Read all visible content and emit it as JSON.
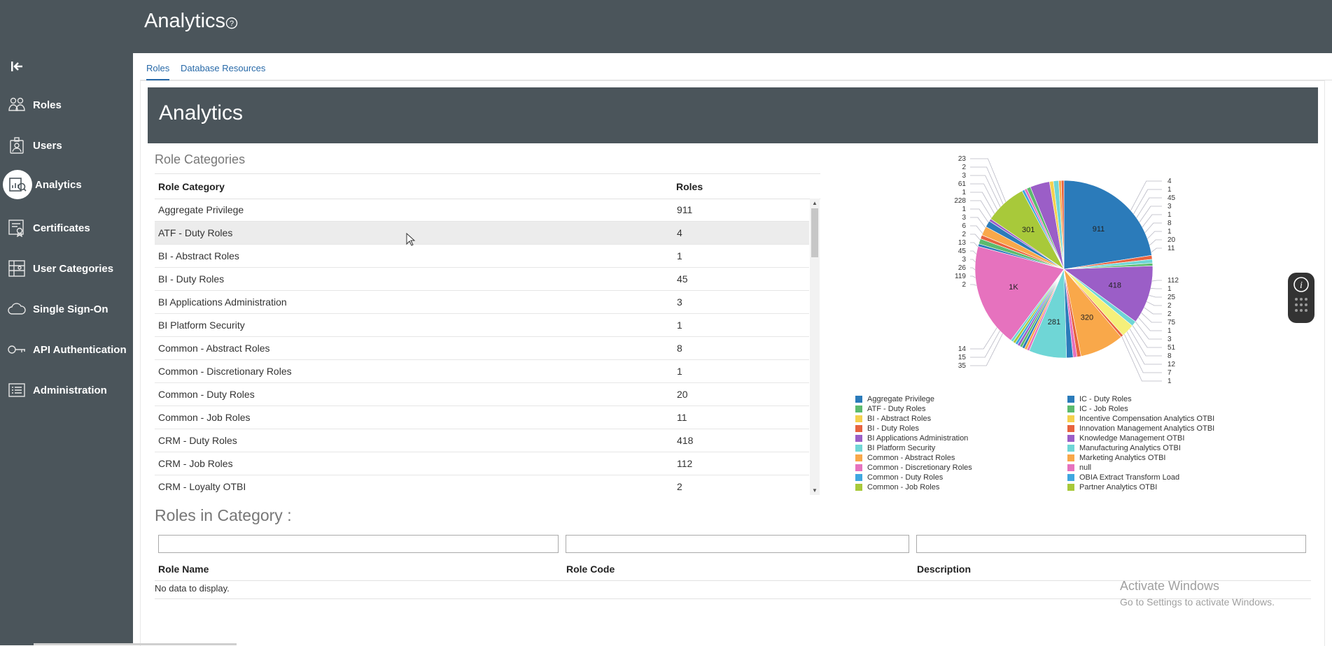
{
  "header": {
    "title": "Analytics",
    "help_icon": "help-circle-icon"
  },
  "sidebar": {
    "collapse_icon": "collapse-left-icon",
    "items": [
      {
        "label": "Roles",
        "icon": "roles-icon"
      },
      {
        "label": "Users",
        "icon": "user-badge-icon"
      },
      {
        "label": "Analytics",
        "icon": "analytics-icon",
        "active": true
      },
      {
        "label": "Certificates",
        "icon": "certificate-icon"
      },
      {
        "label": "User Categories",
        "icon": "user-categories-icon"
      },
      {
        "label": "Single Sign-On",
        "icon": "cloud-icon"
      },
      {
        "label": "API Authentication",
        "icon": "key-icon"
      },
      {
        "label": "Administration",
        "icon": "list-icon"
      }
    ]
  },
  "tabs": [
    {
      "label": "Roles",
      "active": true
    },
    {
      "label": "Database Resources"
    }
  ],
  "banner": {
    "title": "Analytics"
  },
  "role_categories": {
    "title": "Role Categories",
    "col_category": "Role Category",
    "col_roles": "Roles",
    "rows": [
      {
        "category": "Aggregate Privilege",
        "roles": "911"
      },
      {
        "category": "ATF - Duty Roles",
        "roles": "4"
      },
      {
        "category": "BI - Abstract Roles",
        "roles": "1"
      },
      {
        "category": "BI - Duty Roles",
        "roles": "45"
      },
      {
        "category": "BI Applications Administration",
        "roles": "3"
      },
      {
        "category": "BI Platform Security",
        "roles": "1"
      },
      {
        "category": "Common - Abstract Roles",
        "roles": "8"
      },
      {
        "category": "Common - Discretionary Roles",
        "roles": "1"
      },
      {
        "category": "Common - Duty Roles",
        "roles": "20"
      },
      {
        "category": "Common - Job Roles",
        "roles": "11"
      },
      {
        "category": "CRM - Duty Roles",
        "roles": "418"
      },
      {
        "category": "CRM - Job Roles",
        "roles": "112"
      },
      {
        "category": "CRM - Loyalty OTBI",
        "roles": "2"
      }
    ]
  },
  "roles_in_category": {
    "title": "Roles in Category :",
    "col_name": "Role Name",
    "col_code": "Role Code",
    "col_desc": "Description",
    "empty": "No data to display."
  },
  "chart_data": {
    "type": "pie",
    "slice_labels": [
      "911",
      "418",
      "320",
      "281",
      "1K",
      "301"
    ],
    "callouts_right": [
      "4",
      "1",
      "45",
      "3",
      "1",
      "8",
      "1",
      "20",
      "11",
      "112",
      "1",
      "25",
      "2",
      "2",
      "75",
      "1",
      "3",
      "51",
      "8",
      "12",
      "7",
      "1"
    ],
    "callouts_left": [
      "23",
      "2",
      "3",
      "61",
      "1",
      "228",
      "1",
      "3",
      "6",
      "2",
      "13",
      "45",
      "3",
      "26",
      "119",
      "2",
      "14",
      "15",
      "35"
    ],
    "legend": [
      {
        "name": "Aggregate Privilege",
        "color": "#2b7bba"
      },
      {
        "name": "ATF - Duty Roles",
        "color": "#5cbb6e"
      },
      {
        "name": "BI - Abstract Roles",
        "color": "#f5d04d"
      },
      {
        "name": "BI - Duty Roles",
        "color": "#e8633f"
      },
      {
        "name": "BI Applications Administration",
        "color": "#9b5ec7"
      },
      {
        "name": "BI Platform Security",
        "color": "#6fd6d6"
      },
      {
        "name": "Common - Abstract Roles",
        "color": "#f9a84a"
      },
      {
        "name": "Common - Discretionary Roles",
        "color": "#e672be"
      },
      {
        "name": "Common - Duty Roles",
        "color": "#3fa7e0"
      },
      {
        "name": "Common - Job Roles",
        "color": "#a8c93a"
      },
      {
        "name": "IC - Duty Roles",
        "color": "#2b7bba"
      },
      {
        "name": "IC - Job Roles",
        "color": "#5cbb6e"
      },
      {
        "name": "Incentive Compensation Analytics OTBI",
        "color": "#f5d04d"
      },
      {
        "name": "Innovation Management Analytics OTBI",
        "color": "#e8633f"
      },
      {
        "name": "Knowledge Management OTBI",
        "color": "#9b5ec7"
      },
      {
        "name": "Manufacturing Analytics OTBI",
        "color": "#6fd6d6"
      },
      {
        "name": "Marketing Analytics OTBI",
        "color": "#f9a84a"
      },
      {
        "name": "null",
        "color": "#e672be"
      },
      {
        "name": "OBIA Extract Transform Load",
        "color": "#3fa7e0"
      },
      {
        "name": "Partner Analytics OTBI",
        "color": "#a8c93a"
      }
    ]
  },
  "watermark": {
    "line1": "Activate Windows",
    "line2": "Go to Settings to activate Windows."
  }
}
